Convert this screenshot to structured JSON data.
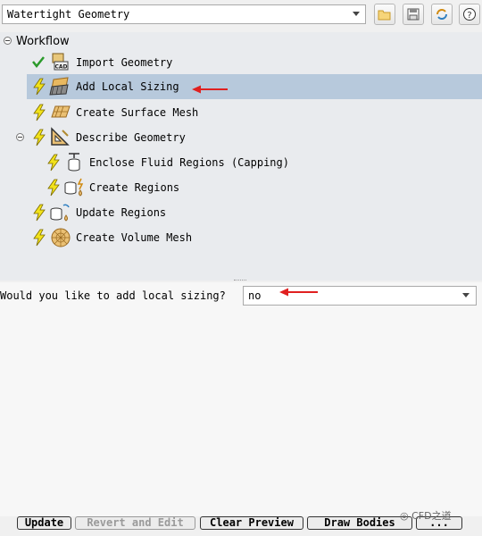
{
  "toolbar": {
    "workflow_select_value": "Watertight Geometry",
    "buttons": [
      "folder-open-icon",
      "save-icon",
      "refresh-icon",
      "help-icon"
    ]
  },
  "tree": {
    "root_label": "Workflow",
    "items": [
      {
        "label": "Import Geometry",
        "status": "done",
        "icon": "cad-import-icon"
      },
      {
        "label": "Add Local Sizing",
        "status": "pending",
        "icon": "local-sizing-icon",
        "selected": true
      },
      {
        "label": "Create Surface Mesh",
        "status": "pending",
        "icon": "surface-mesh-icon"
      },
      {
        "label": "Describe Geometry",
        "status": "pending",
        "icon": "describe-geometry-icon"
      },
      {
        "label": "Enclose Fluid Regions (Capping)",
        "status": "pending",
        "icon": "capping-icon"
      },
      {
        "label": "Create Regions",
        "status": "pending",
        "icon": "create-regions-icon"
      },
      {
        "label": "Update Regions",
        "status": "pending",
        "icon": "update-regions-icon"
      },
      {
        "label": "Create Volume Mesh",
        "status": "pending",
        "icon": "volume-mesh-icon"
      }
    ]
  },
  "properties": {
    "question": "Would you like to add local sizing?",
    "answer": "no"
  },
  "buttons": {
    "update": "Update",
    "revert": "Revert and Edit",
    "clear_preview": "Clear Preview",
    "draw_bodies": "Draw Bodies",
    "more": "..."
  },
  "watermark": "CFD之道",
  "colors": {
    "selected_row": "#b7c9dc",
    "pending_bolt": "#f2e21a",
    "done_check": "#2a9a2a",
    "annotation_arrow": "#e02020"
  }
}
